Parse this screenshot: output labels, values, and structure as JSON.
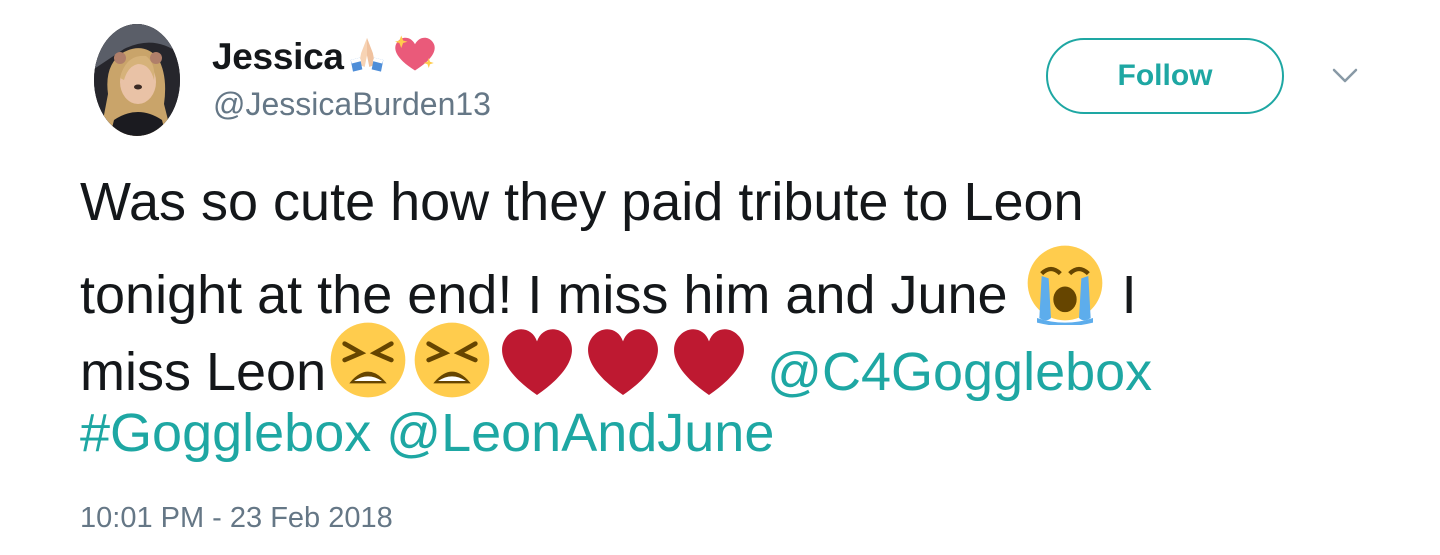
{
  "user": {
    "display_name": "Jessica",
    "handle": "@JessicaBurden13",
    "name_emojis": [
      "folded-hands-emoji",
      "sparkling-heart-emoji"
    ]
  },
  "actions": {
    "follow_label": "Follow",
    "menu_icon": "chevron-down-icon"
  },
  "tweet": {
    "line1": "Was so cute how they paid tribute to Leon",
    "line2_text": "tonight at the end! I miss him and June ",
    "line2_after": " I",
    "line3_text": "miss Leon",
    "mention_c4": "@C4Gogglebox",
    "hashtag": "#Gogglebox",
    "mention_leonjune": "@LeonAndJune",
    "emojis": [
      "loudly-crying-face",
      "tired-face",
      "tired-face",
      "red-heart",
      "red-heart",
      "red-heart"
    ]
  },
  "timestamp": "10:01 PM - 23 Feb 2018",
  "colors": {
    "link": "#1ea7a3",
    "text": "#14171a",
    "muted": "#657786"
  }
}
